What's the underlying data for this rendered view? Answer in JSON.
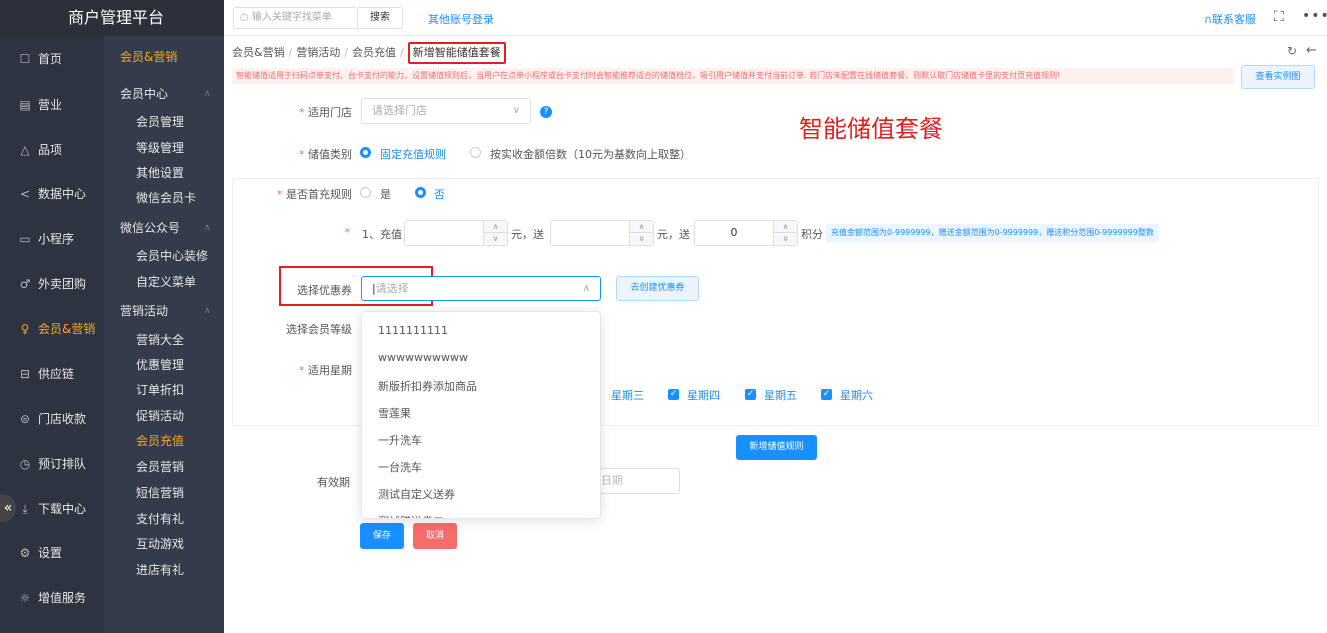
{
  "brand": "商户管理平台",
  "sidebar_primary": [
    {
      "label": "首页",
      "icon": "☐"
    },
    {
      "label": "营业",
      "icon": "▤"
    },
    {
      "label": "品项",
      "icon": "△"
    },
    {
      "label": "数据中心",
      "icon": "<"
    },
    {
      "label": "小程序",
      "icon": "▭"
    },
    {
      "label": "外卖团购",
      "icon": "♂"
    },
    {
      "label": "会员&营销",
      "icon": "♀"
    },
    {
      "label": "供应链",
      "icon": "⊟"
    },
    {
      "label": "门店收款",
      "icon": "⊜"
    },
    {
      "label": "预订排队",
      "icon": "◷"
    },
    {
      "label": "下载中心",
      "icon": "⤓"
    },
    {
      "label": "设置",
      "icon": "⚙"
    },
    {
      "label": "增值服务",
      "icon": "☼"
    }
  ],
  "sidebar_secondary": {
    "header": "会员&营销",
    "groups": [
      "会员中心",
      "微信公众号",
      "营销活动"
    ],
    "items": [
      "会员管理",
      "等级管理",
      "其他设置",
      "微信会员卡",
      "会员中心装修",
      "自定义菜单",
      "营销大全",
      "优惠管理",
      "订单折扣",
      "促销活动",
      "会员充值",
      "会员营销",
      "短信营销",
      "支付有礼",
      "互动游戏",
      "进店有礼"
    ]
  },
  "collapse_symbol": "«",
  "topbar": {
    "search_placeholder": "输入关键字找菜单",
    "search_button": "搜索",
    "other_login": "其他账号登录",
    "contact": "联系客服",
    "more": "•••"
  },
  "breadcrumb": [
    "会员&营销",
    "营销活动",
    "会员充值",
    "新增智能储值套餐"
  ],
  "notice": "智能储值适用于扫码点单支付、台卡支付的能力，设置储值规则后，当用户在点单小程序或台卡支付时会智能推荐适合的储值档位，吸引用户储值并支付当前订单. 若门店未配置在线储值套餐，则默认取门店储值卡里的支付页充值规则!",
  "example_button": "查看实例图",
  "page_title": "智能储值套餐",
  "form": {
    "store_label": "适用门店",
    "store_placeholder": "请选择门店",
    "type_label": "储值类别",
    "type_options": [
      "固定充值规则",
      "按实收金额倍数（10元为基数向上取整）"
    ],
    "first_label": "是否首充规则",
    "first_options": [
      "是",
      "否"
    ],
    "rule_index": "1、充值",
    "unit_yuan_give": "元，送",
    "unit_yuan_give2": "元，送",
    "points_value": "0",
    "points_label": "积分",
    "range_hint": "充值金额范围为0-9999999，赠送金额范围为0-9999999，赠送积分范围0-9999999整数",
    "coupon_label": "选择优惠券",
    "coupon_placeholder": "请选择",
    "create_coupon": "去创建优惠券",
    "level_label": "选择会员等级",
    "week_label": "适用星期",
    "weekdays": [
      "星期三",
      "星期四",
      "星期五",
      "星期六"
    ],
    "add_rule": "新增储值规则",
    "valid_label": "有效期",
    "date_placeholder": "日期",
    "save": "保存",
    "cancel": "取消"
  },
  "coupon_options": [
    "1111111111",
    "wwwwwwwwww",
    "新版折扣券添加商品",
    "雪莲果",
    "一升洗车",
    "一台洗车",
    "测试自定义送券",
    "测试赠送券二"
  ]
}
